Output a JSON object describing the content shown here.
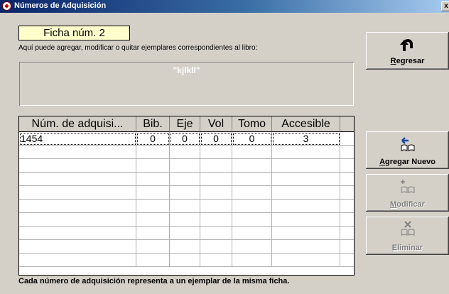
{
  "window": {
    "title": "Números de Adquisición",
    "close_glyph": "x"
  },
  "ficha_label": "Ficha núm. 2",
  "help_text": "Aquí puede agregar, modificar o quitar ejemplares correspondientes al libro:",
  "book_title": "\"kjlkll\"",
  "table": {
    "columns": [
      "Núm. de adquisi...",
      "Bib.",
      "Eje",
      "Vol",
      "Tomo",
      "Accesible"
    ],
    "rows": [
      [
        "1454",
        "0",
        "0",
        "0",
        "0",
        "3"
      ]
    ],
    "empty_rows": 9
  },
  "footer_text": "Cada número de adquisición representa a un ejemplar de la misma ficha.",
  "buttons": {
    "regresar": {
      "label": "Regresar",
      "icon": "u-turn-arrow-icon"
    },
    "agregar": {
      "label": "Agregar Nuevo",
      "icon": "add-book-icon"
    },
    "modificar": {
      "label": "Modificar",
      "icon": "edit-book-icon",
      "enabled": false
    },
    "eliminar": {
      "label": "Eliminar",
      "icon": "delete-book-icon",
      "enabled": false
    }
  }
}
